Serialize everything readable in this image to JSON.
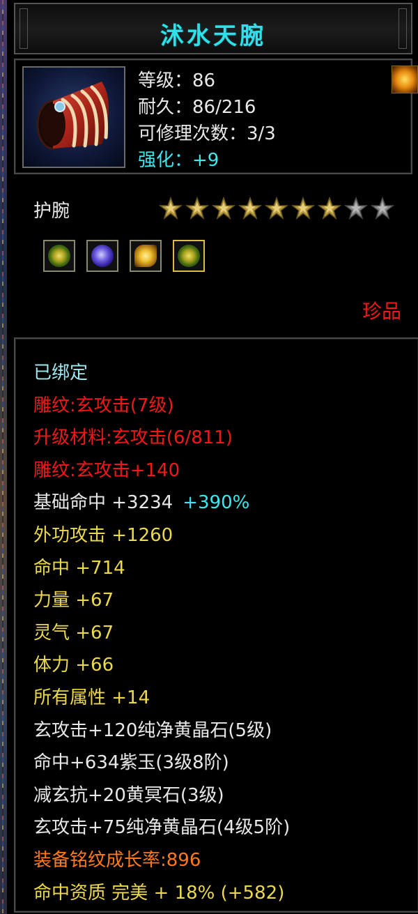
{
  "item": {
    "name": "沭水天腕",
    "level": "等级：86",
    "durability": "耐久：86/216",
    "repair": "可修理次数：3/3",
    "enhance": "强化：+9",
    "type": "护腕",
    "stars_filled": 7,
    "stars_total": 9,
    "quality": "珍品",
    "icon": "bracer-icon",
    "badge_icon": "flame-badge-icon",
    "gems": [
      "yellow-green-gem-icon",
      "purple-jade-gem-icon",
      "yellow-crystal-gem-icon",
      "yellow-green-gem-icon"
    ]
  },
  "attributes": [
    {
      "text": "已绑定",
      "color": "cyan"
    },
    {
      "text": "雕纹:玄攻击(7级)",
      "color": "red"
    },
    {
      "text": "升级材料:玄攻击(6/811)",
      "color": "red"
    },
    {
      "text": "雕纹:玄攻击+140",
      "color": "red"
    },
    {
      "text": "基础命中 +3234",
      "color": "white",
      "extra": "+390%"
    },
    {
      "text": "外功攻击 +1260",
      "color": "yellow"
    },
    {
      "text": "命中 +714",
      "color": "yellow"
    },
    {
      "text": "力量 +67",
      "color": "yellow"
    },
    {
      "text": "灵气 +67",
      "color": "yellow"
    },
    {
      "text": "体力 +66",
      "color": "yellow"
    },
    {
      "text": "所有属性 +14",
      "color": "yellow"
    },
    {
      "text": "玄攻击+120纯净黄晶石(5级)",
      "color": "white"
    },
    {
      "text": "命中+634紫玉(3级8阶)",
      "color": "white"
    },
    {
      "text": "减玄抗+20黄冥石(3级)",
      "color": "white"
    },
    {
      "text": "玄攻击+75纯净黄晶石(4级5阶)",
      "color": "white"
    },
    {
      "text": "装备铭纹成长率:896",
      "color": "orange"
    },
    {
      "text": "命中资质 完美 + 18% (+582)",
      "color": "yellow"
    }
  ],
  "colors": {
    "title": "#2ee0e8",
    "cyan": "#3ee6ee",
    "red": "#f01818",
    "white": "#e8e8e8",
    "yellow": "#ecd84c",
    "orange": "#ff7a1a"
  }
}
